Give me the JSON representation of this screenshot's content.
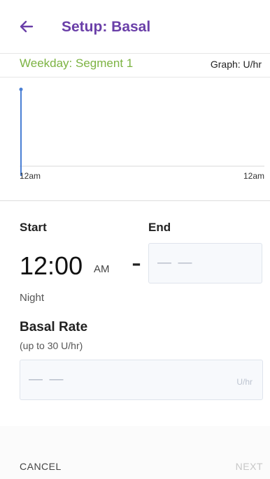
{
  "header": {
    "title": "Setup: Basal",
    "back_icon": "arrow-left-icon"
  },
  "segment": {
    "label": "Weekday: Segment 1",
    "graph_unit": "Graph: U/hr"
  },
  "graph": {
    "x_start": "12am",
    "x_end": "12am"
  },
  "schedule": {
    "start_label": "Start",
    "end_label": "End",
    "start_time": "12:00",
    "start_ampm": "AM",
    "separator": "-",
    "end_value": "— —",
    "period": "Night"
  },
  "basal": {
    "label": "Basal Rate",
    "limit": "(up to 30 U/hr)",
    "value": "— —",
    "unit": "U/hr"
  },
  "footer": {
    "cancel": "CANCEL",
    "next": "NEXT"
  },
  "colors": {
    "accent": "#6a3fa8",
    "segment": "#7cb342",
    "graph_line": "#4a7fd4"
  }
}
